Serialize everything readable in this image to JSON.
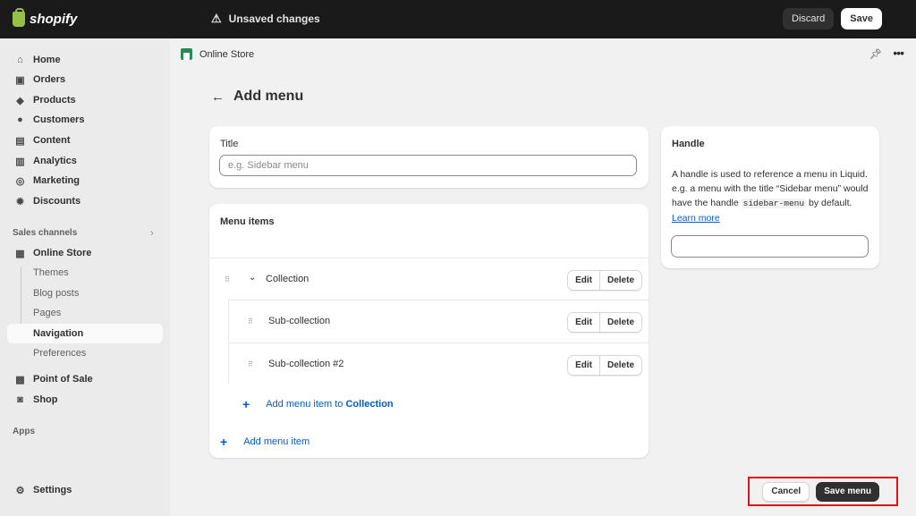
{
  "topbar": {
    "logo_text": "shopify",
    "unsaved_text": "Unsaved changes",
    "discard_label": "Discard",
    "save_label": "Save"
  },
  "sidebar": {
    "items": [
      {
        "label": "Home",
        "icon": "home-icon"
      },
      {
        "label": "Orders",
        "icon": "orders-icon"
      },
      {
        "label": "Products",
        "icon": "tag-icon"
      },
      {
        "label": "Customers",
        "icon": "person-icon"
      },
      {
        "label": "Content",
        "icon": "content-icon"
      },
      {
        "label": "Analytics",
        "icon": "bar-chart-icon"
      },
      {
        "label": "Marketing",
        "icon": "target-icon"
      },
      {
        "label": "Discounts",
        "icon": "discount-icon"
      }
    ],
    "sales_channels_label": "Sales channels",
    "online_store": "Online Store",
    "online_store_subitems": [
      "Themes",
      "Blog posts",
      "Pages",
      "Navigation",
      "Preferences"
    ],
    "point_of_sale": "Point of Sale",
    "shop": "Shop",
    "apps_label": "Apps",
    "settings": "Settings"
  },
  "header": {
    "app_title": "Online Store",
    "page_title": "Add menu"
  },
  "title_card": {
    "label": "Title",
    "placeholder": "e.g. Sidebar menu"
  },
  "menu_items": {
    "heading": "Menu items",
    "rows": [
      {
        "label": "Collection"
      },
      {
        "label": "Sub-collection"
      },
      {
        "label": "Sub-collection #2"
      }
    ],
    "edit_label": "Edit",
    "delete_label": "Delete",
    "add_nested_prefix": "Add menu item to",
    "add_nested_target": "Collection",
    "add_item": "Add menu item"
  },
  "handle_card": {
    "heading": "Handle",
    "text_1": "A handle is used to reference a menu in Liquid. e.g. a menu with the title “Sidebar menu” would have the handle",
    "code": "sidebar-menu",
    "text_2": "by default.",
    "learn_more": "Learn more"
  },
  "footer": {
    "cancel_label": "Cancel",
    "save_label": "Save menu"
  }
}
